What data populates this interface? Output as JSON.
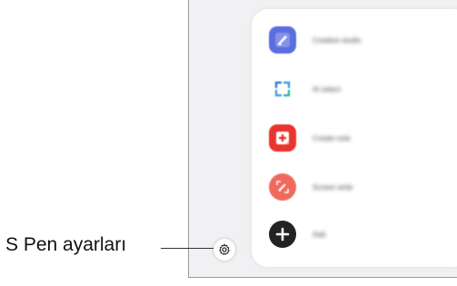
{
  "callout": {
    "label": "S Pen ayarları"
  },
  "air_command": {
    "items": [
      {
        "label": "Creative studio",
        "icon": "creative-studio-icon",
        "color": "#5a6ee0"
      },
      {
        "label": "AI select",
        "icon": "ai-select-icon",
        "color": "#3aa1e0"
      },
      {
        "label": "Create note",
        "icon": "create-note-icon",
        "color": "#e8352f"
      },
      {
        "label": "Screen write",
        "icon": "screen-write-icon",
        "color": "#ef6a5d"
      },
      {
        "label": "Add",
        "icon": "add-icon",
        "color": "#232323"
      }
    ]
  },
  "settings": {
    "icon": "settings-gear-icon"
  }
}
